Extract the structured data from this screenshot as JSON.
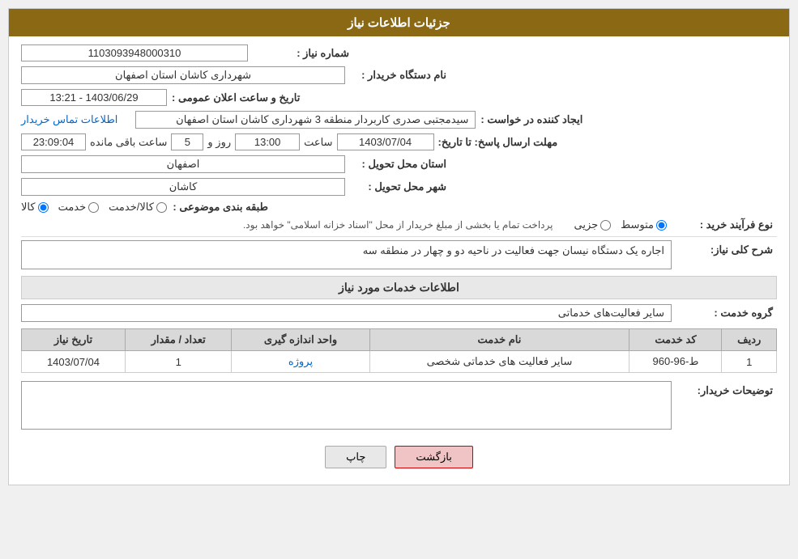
{
  "header": {
    "title": "جزئیات اطلاعات نیاز"
  },
  "fields": {
    "shomare_niaz_label": "شماره نیاز :",
    "shomare_niaz_value": "1103093948000310",
    "nam_dastgah_label": "نام دستگاه خریدار :",
    "nam_dastgah_value": "شهرداری کاشان استان اصفهان",
    "announce_date_label": "تاریخ و ساعت اعلان عمومی :",
    "announce_date_value": "1403/06/29 - 13:21",
    "ijad_label": "ایجاد کننده در خواست :",
    "ijad_value": "سیدمجتبی صدری کاربردار منطقه 3 شهرداری کاشان استان اصفهان",
    "contact_link": "اطلاعات تماس خریدار",
    "mohlat_label": "مهلت ارسال پاسخ: تا تاریخ:",
    "mohlat_date": "1403/07/04",
    "mohlat_time_label": "ساعت",
    "mohlat_time": "13:00",
    "mohlat_days_label": "روز و",
    "mohlat_days": "5",
    "mohlat_remaining_label": "ساعت باقی مانده",
    "mohlat_remaining": "23:09:04",
    "ostan_label": "استان محل تحویل :",
    "ostan_value": "اصفهان",
    "shahr_label": "شهر محل تحویل :",
    "shahr_value": "کاشان",
    "tabagheh_label": "طبقه بندی موضوعی :",
    "tabagheh_options": [
      "کالا",
      "خدمت",
      "کالا/خدمت"
    ],
    "tabagheh_selected": "کالا",
    "nawf_label": "نوع فرآیند خرید :",
    "nawf_options": [
      "جزیی",
      "متوسط"
    ],
    "nawf_selected": "متوسط",
    "nawf_note": "پرداخت تمام یا بخشی از مبلغ خریدار از محل \"اسناد خزانه اسلامی\" خواهد بود.",
    "sharh_label": "شرح کلی نیاز:",
    "sharh_value": "اجاره یک دستگاه نیسان جهت فعالیت در ناحیه دو و چهار در منطقه سه",
    "service_info_title": "اطلاعات خدمات مورد نیاز",
    "group_label": "گروه خدمت :",
    "group_value": "سایر فعالیت‌های خدماتی",
    "table": {
      "headers": [
        "ردیف",
        "کد خدمت",
        "نام خدمت",
        "واحد اندازه گیری",
        "تعداد / مقدار",
        "تاریخ نیاز"
      ],
      "rows": [
        {
          "radif": "1",
          "code": "ط-96-960",
          "name": "سایر فعالیت های خدماتی شخصی",
          "unit": "پروژه",
          "count": "1",
          "date": "1403/07/04"
        }
      ]
    },
    "tawzih_label": "توضیحات خریدار:",
    "tawzih_value": ""
  },
  "buttons": {
    "print_label": "چاپ",
    "back_label": "بازگشت"
  }
}
